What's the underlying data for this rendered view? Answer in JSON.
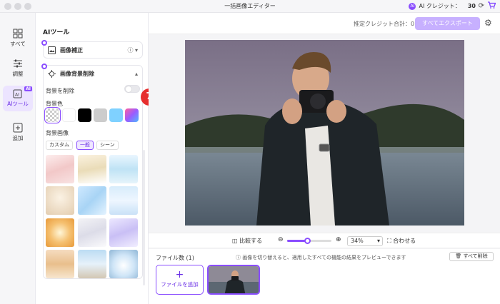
{
  "window": {
    "title": "一括画像エディター"
  },
  "credits": {
    "label": "AI クレジット：",
    "value": "30",
    "ai_mark": "AI"
  },
  "nav": {
    "items": [
      {
        "label": "すべて",
        "icon": "grid-icon"
      },
      {
        "label": "調整",
        "icon": "sliders-icon"
      },
      {
        "label": "AIツール",
        "icon": "ai-tool-icon",
        "badge": "AI"
      },
      {
        "label": "追加",
        "icon": "plus-square-icon"
      }
    ]
  },
  "panel": {
    "title": "AIツール",
    "tools": [
      {
        "label": "画像補正",
        "icon": "image-enhance-icon",
        "expanded": false
      },
      {
        "label": "画像背景削除",
        "icon": "background-remove-icon",
        "expanded": true
      }
    ],
    "remove_bg_label": "背景を削除",
    "remove_bg_enabled": false,
    "marker": "7",
    "bg_color_label": "背景色",
    "colors": [
      "transparent",
      "#ffffff",
      "#000000",
      "#cccccc",
      "#7fd1ff",
      "gradient"
    ],
    "bg_image_label": "背景画像",
    "bg_tabs": [
      "カスタム",
      "一般",
      "シーン"
    ],
    "bg_tab_active": "一般"
  },
  "topbar": {
    "estimate_label": "推定クレジット合計：",
    "estimate_value": "0",
    "export_label": "すべてエクスポート"
  },
  "viewer": {
    "compare_label": "比較する",
    "zoom_value": "34%",
    "zoom_fraction": 0.45,
    "fit_label": "合わせる"
  },
  "files": {
    "count_label": "ファイル数 (1)",
    "info": "画像を切り替えると、適用したすべての機能の結果をプレビューできます",
    "delete_all_label": "すべて削除",
    "add_label": "ファイルを追加"
  }
}
